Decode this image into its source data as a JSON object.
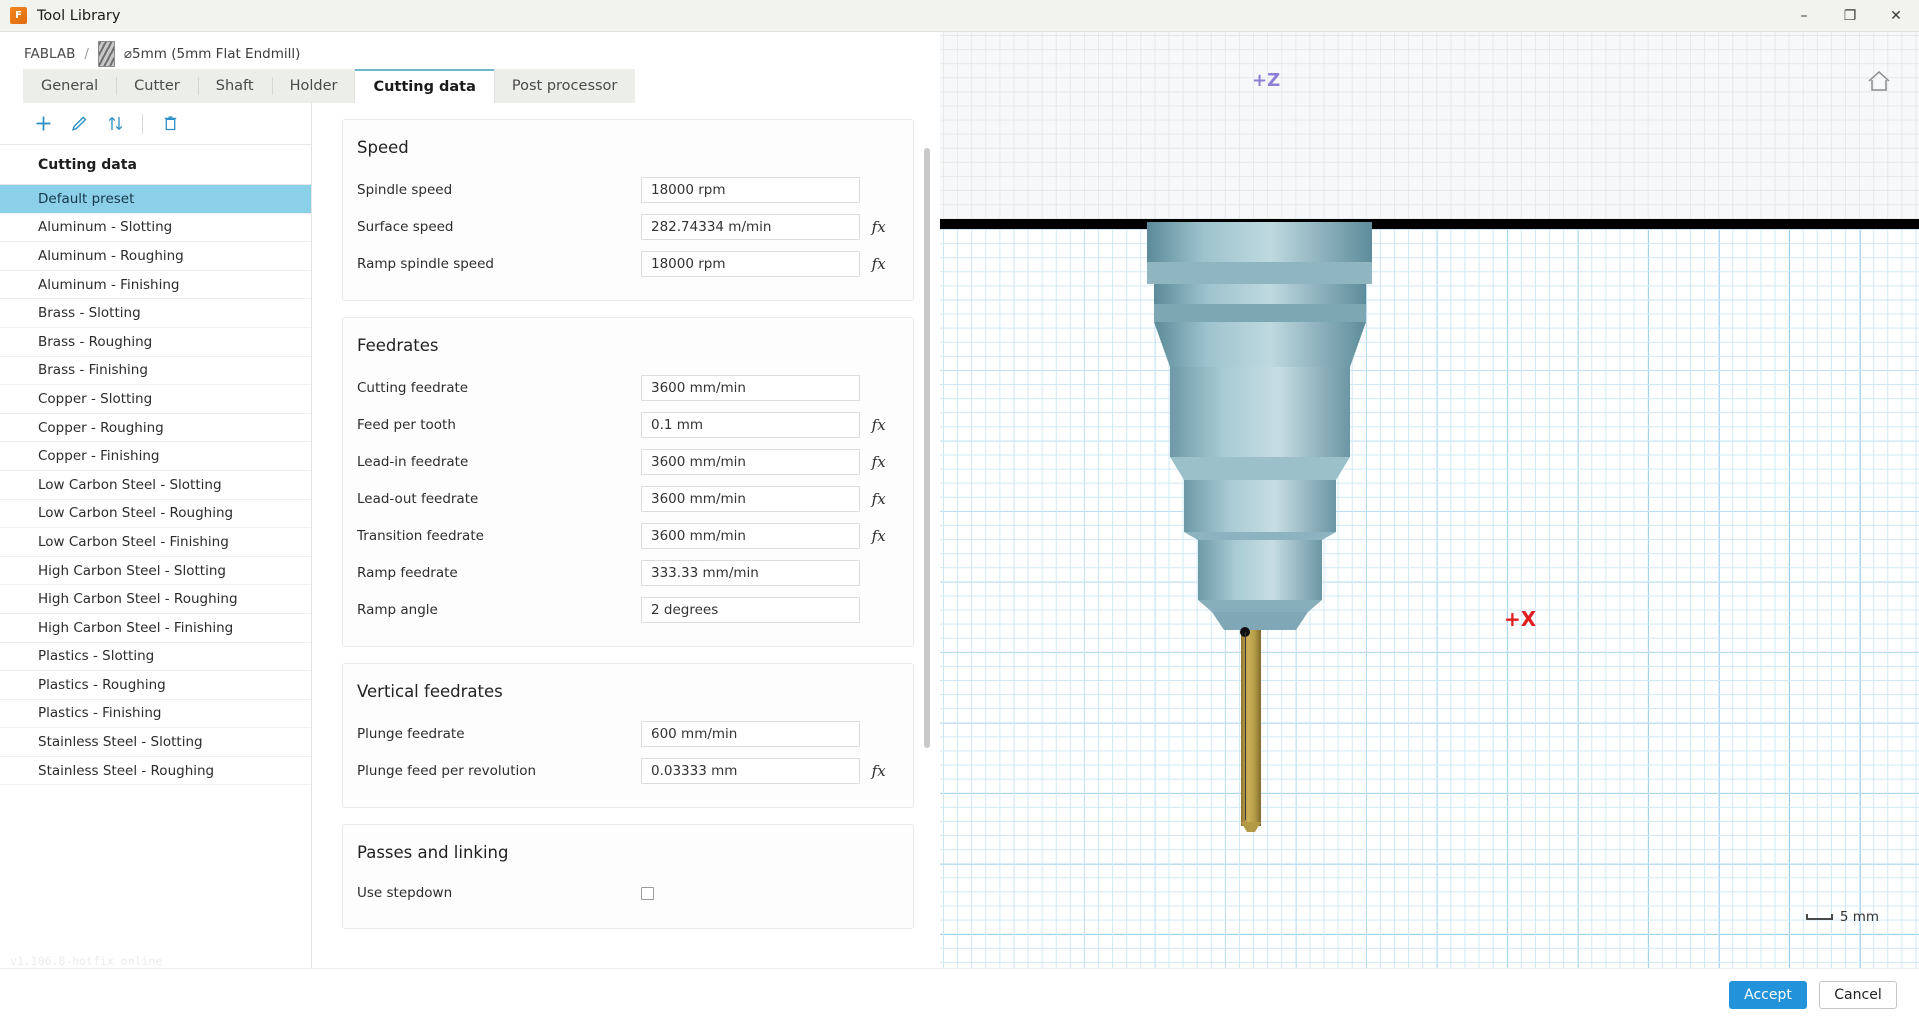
{
  "window": {
    "title": "Tool Library",
    "app_icon": "fusion-logo-icon",
    "minimize_label": "–",
    "maximize_label": "❐",
    "close_label": "✕"
  },
  "breadcrumb": {
    "root": "FABLAB",
    "separator": "/",
    "tool_name": "⌀5mm (5mm Flat Endmill)"
  },
  "tabs": [
    {
      "label": "General",
      "active": false
    },
    {
      "label": "Cutter",
      "active": false
    },
    {
      "label": "Shaft",
      "active": false
    },
    {
      "label": "Holder",
      "active": false
    },
    {
      "label": "Cutting data",
      "active": true
    },
    {
      "label": "Post processor",
      "active": false
    }
  ],
  "sidebar": {
    "toolbar": [
      {
        "name": "add-preset-button",
        "glyph": "+"
      },
      {
        "name": "edit-preset-button",
        "glyph": "✎"
      },
      {
        "name": "sort-preset-button",
        "glyph": "⇅"
      },
      {
        "name": "delete-preset-button",
        "glyph": "Ὕ1"
      }
    ],
    "header": "Cutting data",
    "items": [
      {
        "label": "Default preset",
        "selected": true
      },
      {
        "label": "Aluminum - Slotting",
        "selected": false
      },
      {
        "label": "Aluminum - Roughing",
        "selected": false
      },
      {
        "label": "Aluminum - Finishing",
        "selected": false
      },
      {
        "label": "Brass - Slotting",
        "selected": false
      },
      {
        "label": "Brass - Roughing",
        "selected": false
      },
      {
        "label": "Brass - Finishing",
        "selected": false
      },
      {
        "label": "Copper - Slotting",
        "selected": false
      },
      {
        "label": "Copper - Roughing",
        "selected": false
      },
      {
        "label": "Copper - Finishing",
        "selected": false
      },
      {
        "label": "Low Carbon Steel - Slotting",
        "selected": false
      },
      {
        "label": "Low Carbon Steel - Roughing",
        "selected": false
      },
      {
        "label": "Low Carbon Steel - Finishing",
        "selected": false
      },
      {
        "label": "High Carbon Steel - Slotting",
        "selected": false
      },
      {
        "label": "High Carbon Steel - Roughing",
        "selected": false
      },
      {
        "label": "High Carbon Steel - Finishing",
        "selected": false
      },
      {
        "label": "Plastics - Slotting",
        "selected": false
      },
      {
        "label": "Plastics - Roughing",
        "selected": false
      },
      {
        "label": "Plastics - Finishing",
        "selected": false
      },
      {
        "label": "Stainless Steel - Slotting",
        "selected": false
      },
      {
        "label": "Stainless Steel - Roughing",
        "selected": false
      }
    ]
  },
  "form": {
    "sections": [
      {
        "title": "Speed",
        "fields": [
          {
            "label": "Spindle speed",
            "value": "18000 rpm",
            "fx": false
          },
          {
            "label": "Surface speed",
            "value": "282.74334 m/min",
            "fx": true
          },
          {
            "label": "Ramp spindle speed",
            "value": "18000 rpm",
            "fx": true
          }
        ]
      },
      {
        "title": "Feedrates",
        "fields": [
          {
            "label": "Cutting feedrate",
            "value": "3600 mm/min",
            "fx": false
          },
          {
            "label": "Feed per tooth",
            "value": "0.1 mm",
            "fx": true
          },
          {
            "label": "Lead-in feedrate",
            "value": "3600 mm/min",
            "fx": true
          },
          {
            "label": "Lead-out feedrate",
            "value": "3600 mm/min",
            "fx": true
          },
          {
            "label": "Transition feedrate",
            "value": "3600 mm/min",
            "fx": true
          },
          {
            "label": "Ramp feedrate",
            "value": "333.33 mm/min",
            "fx": false
          },
          {
            "label": "Ramp angle",
            "value": "2 degrees",
            "fx": false
          }
        ]
      },
      {
        "title": "Vertical feedrates",
        "fields": [
          {
            "label": "Plunge feedrate",
            "value": "600 mm/min",
            "fx": false
          },
          {
            "label": "Plunge feed per revolution",
            "value": "0.03333 mm",
            "fx": true
          }
        ]
      },
      {
        "title": "Passes and linking",
        "checkbox_fields": [
          {
            "label": "Use stepdown",
            "checked": false
          }
        ]
      }
    ],
    "fx_symbol": "fx"
  },
  "viewport": {
    "axis_z_label": "+Z",
    "axis_x_label": "+X",
    "home_icon": "home-icon",
    "scale_label": "5 mm"
  },
  "footer": {
    "version": "v1.106.8-hotfix online",
    "accept_label": "Accept",
    "cancel_label": "Cancel"
  },
  "colors": {
    "accent_blue": "#2292da",
    "selected_row": "#8ccfe8",
    "tab_active_border": "#6fb7c9",
    "grid_major": "#49a6dd",
    "axis_z": "#8f7ed6",
    "axis_x": "#e02020"
  }
}
